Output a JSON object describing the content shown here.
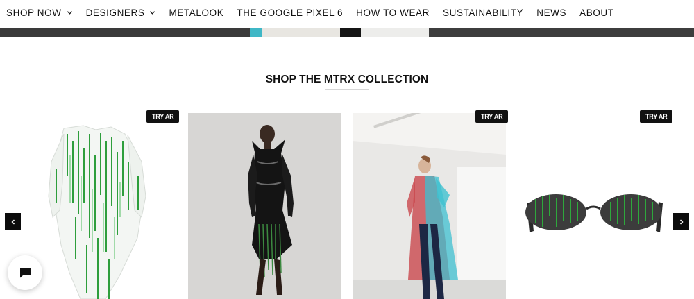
{
  "nav": {
    "items": [
      {
        "label": "SHOP NOW",
        "has_dropdown": true
      },
      {
        "label": "DESIGNERS",
        "has_dropdown": true
      },
      {
        "label": "METALOOK",
        "has_dropdown": false
      },
      {
        "label": "THE GOOGLE PIXEL 6",
        "has_dropdown": false
      },
      {
        "label": "HOW TO WEAR",
        "has_dropdown": false
      },
      {
        "label": "SUSTAINABILITY",
        "has_dropdown": false
      },
      {
        "label": "NEWS",
        "has_dropdown": false
      },
      {
        "label": "ABOUT",
        "has_dropdown": false
      }
    ]
  },
  "section": {
    "title": "SHOP THE MTRX COLLECTION"
  },
  "carousel": {
    "try_ar_label": "TRY AR",
    "prev_icon": "chevron-left-icon",
    "next_icon": "chevron-right-icon",
    "products": [
      {
        "image": "green-matrix-print-transparent-coat",
        "has_try_ar": true
      },
      {
        "image": "black-latex-dress-with-green-fringe",
        "has_try_ar": false
      },
      {
        "image": "red-and-cyan-transparent-coat",
        "has_try_ar": true
      },
      {
        "image": "oval-matrix-lens-sunglasses",
        "has_try_ar": true
      }
    ]
  },
  "chat": {
    "icon": "chat-bubble-icon"
  },
  "colors": {
    "text": "#111111",
    "badge_bg": "#111111",
    "badge_text": "#ffffff",
    "arrow_bg": "#0c0c0c",
    "matrix_green": "#2e9e3c"
  }
}
